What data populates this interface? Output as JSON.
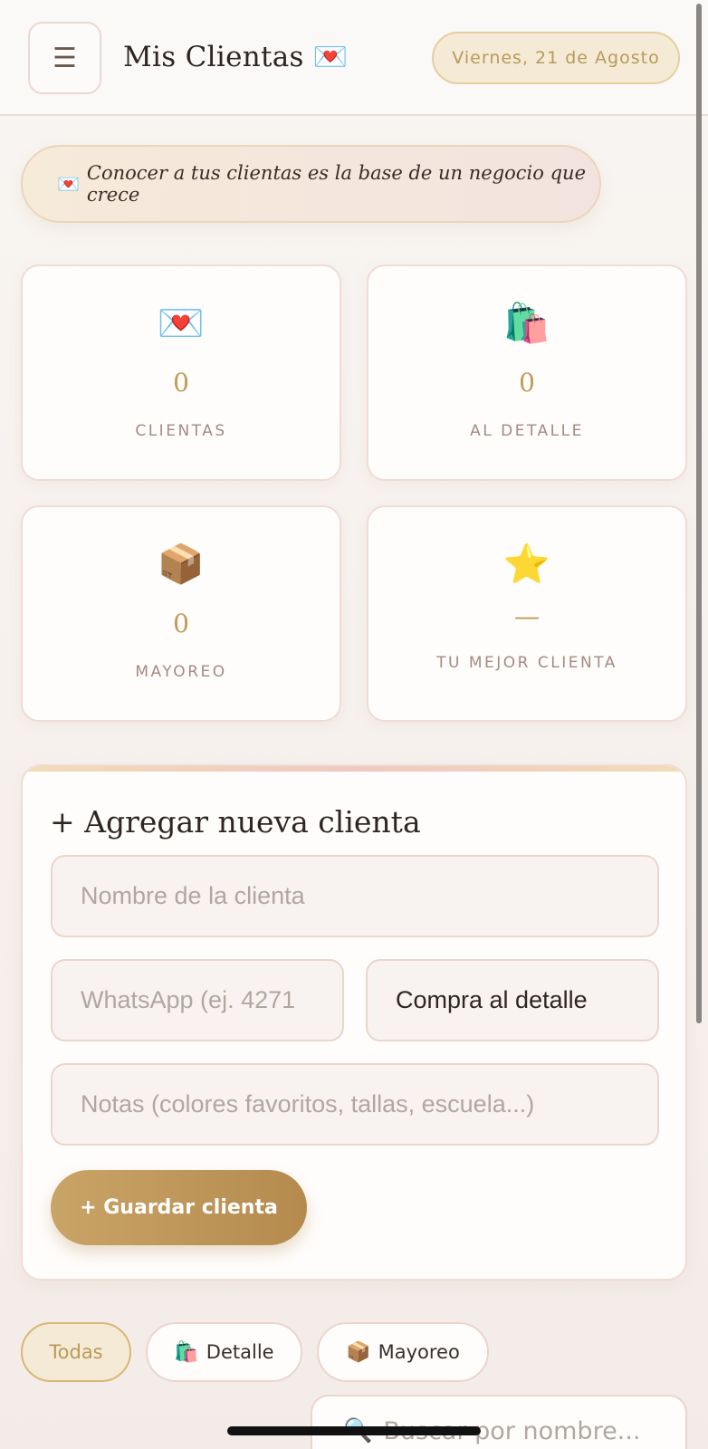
{
  "header": {
    "menu_icon": "☰",
    "title": "Mis Clientas 💌",
    "date": "Viernes, 21 de Agosto"
  },
  "quote": {
    "icon": "💌",
    "text": "Conocer a tus clientas es la base de un negocio que crece"
  },
  "stats": [
    {
      "emoji": "💌",
      "value": "0",
      "label": "CLIENTAS"
    },
    {
      "emoji": "🛍️",
      "value": "0",
      "label": "AL DETALLE"
    },
    {
      "emoji": "📦",
      "value": "0",
      "label": "MAYOREO"
    },
    {
      "emoji": "⭐",
      "value": "—",
      "label": "TU MEJOR CLIENTA"
    }
  ],
  "form": {
    "title": "+ Agregar nueva clienta",
    "name_placeholder": "Nombre de la clienta",
    "whatsapp_placeholder": "WhatsApp (ej. 4271",
    "type_selected": "Compra al detalle",
    "notes_placeholder": "Notas (colores favoritos, tallas, escuela...)",
    "save_label": "+ Guardar clienta"
  },
  "filters": [
    {
      "label": "Todas",
      "icon": ""
    },
    {
      "label": "Detalle",
      "icon": "🛍️"
    },
    {
      "label": "Mayoreo",
      "icon": "📦"
    }
  ],
  "search": {
    "icon": "🔍",
    "placeholder": "Buscar por nombre..."
  }
}
